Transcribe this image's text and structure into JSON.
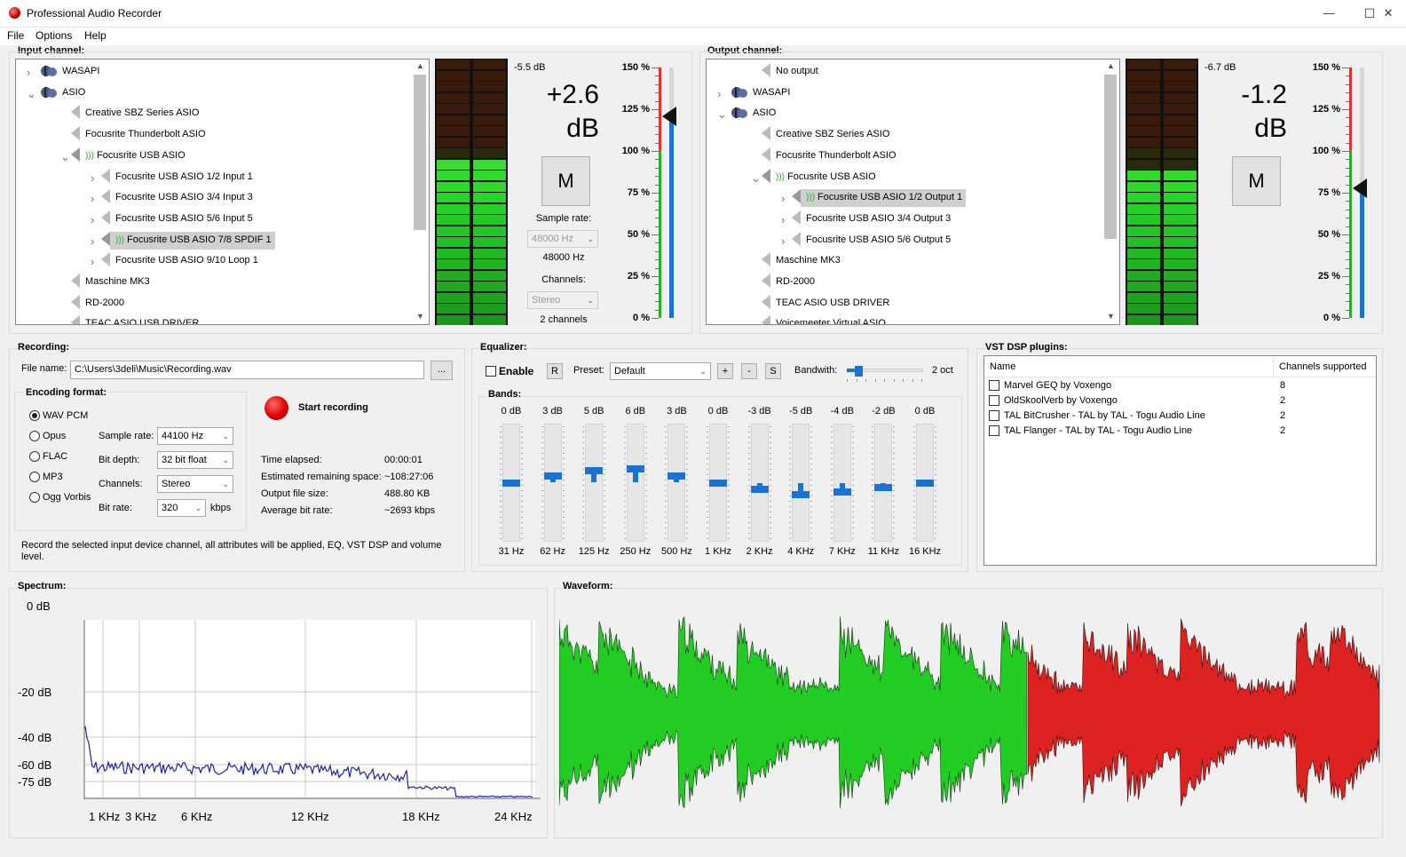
{
  "window": {
    "title": "Professional Audio Recorder",
    "min": "—",
    "max": "☐",
    "close": "✕"
  },
  "menu": [
    "File",
    "Options",
    "Help"
  ],
  "input": {
    "title": "Input channel:",
    "tree": [
      {
        "label": "WASAPI",
        "level": 0,
        "expand": ">",
        "icon": "wasapi"
      },
      {
        "label": "ASIO",
        "level": 0,
        "expand": "v",
        "icon": "wasapi"
      },
      {
        "label": "Creative SBZ Series ASIO",
        "level": 1,
        "expand": "",
        "icon": "spk"
      },
      {
        "label": "Focusrite Thunderbolt ASIO",
        "level": 1,
        "expand": "",
        "icon": "spk"
      },
      {
        "label": "Focusrite USB ASIO",
        "level": 1,
        "expand": "v",
        "icon": "spk-on"
      },
      {
        "label": "Focusrite USB ASIO 1/2 Input 1",
        "level": 2,
        "expand": ">",
        "icon": "spk"
      },
      {
        "label": "Focusrite USB ASIO 3/4 Input 3",
        "level": 2,
        "expand": ">",
        "icon": "spk"
      },
      {
        "label": "Focusrite USB ASIO 5/6 Input 5",
        "level": 2,
        "expand": ">",
        "icon": "spk"
      },
      {
        "label": "Focusrite USB ASIO 7/8 SPDIF 1",
        "level": 2,
        "expand": ">",
        "icon": "spk-on",
        "selected": true
      },
      {
        "label": "Focusrite USB ASIO 9/10 Loop 1",
        "level": 2,
        "expand": ">",
        "icon": "spk"
      },
      {
        "label": "Maschine MK3",
        "level": 1,
        "expand": "",
        "icon": "spk"
      },
      {
        "label": "RD-2000",
        "level": 1,
        "expand": "",
        "icon": "spk"
      },
      {
        "label": "TEAC ASIO USB DRIVER",
        "level": 1,
        "expand": "",
        "icon": "spk"
      }
    ],
    "peak": "-5.5 dB",
    "gain_line1": "+2.6",
    "gain_line2": "dB",
    "mute": "M",
    "sample_rate_label": "Sample rate:",
    "sample_rate_combo": "48000 Hz",
    "sample_rate_value": "48000 Hz",
    "channels_label": "Channels:",
    "channels_combo": "Stereo",
    "channels_value": "2 channels",
    "meter_level": 0.63,
    "volume_level": 0.9
  },
  "output": {
    "title": "Output channel:",
    "tree": [
      {
        "label": "No output",
        "level": 1,
        "expand": "",
        "icon": "spk"
      },
      {
        "label": "WASAPI",
        "level": 0,
        "expand": ">",
        "icon": "wasapi"
      },
      {
        "label": "ASIO",
        "level": 0,
        "expand": "v",
        "icon": "wasapi"
      },
      {
        "label": "Creative SBZ Series ASIO",
        "level": 1,
        "expand": "",
        "icon": "spk"
      },
      {
        "label": "Focusrite Thunderbolt ASIO",
        "level": 1,
        "expand": "",
        "icon": "spk"
      },
      {
        "label": "Focusrite USB ASIO",
        "level": 1,
        "expand": "v",
        "icon": "spk-on"
      },
      {
        "label": "Focusrite USB ASIO 1/2 Output 1",
        "level": 2,
        "expand": ">",
        "icon": "spk-on",
        "selected": true
      },
      {
        "label": "Focusrite USB ASIO 3/4 Output 3",
        "level": 2,
        "expand": ">",
        "icon": "spk"
      },
      {
        "label": "Focusrite USB ASIO 5/6 Output 5",
        "level": 2,
        "expand": ">",
        "icon": "spk"
      },
      {
        "label": "Maschine MK3",
        "level": 1,
        "expand": "",
        "icon": "spk"
      },
      {
        "label": "RD-2000",
        "level": 1,
        "expand": "",
        "icon": "spk"
      },
      {
        "label": "TEAC ASIO USB DRIVER",
        "level": 1,
        "expand": "",
        "icon": "spk"
      },
      {
        "label": "Voicemeeter Virtual ASIO",
        "level": 1,
        "expand": "v",
        "icon": "spk"
      }
    ],
    "peak": "-6.7 dB",
    "gain_line1": "-1.2",
    "gain_line2": "dB",
    "mute": "M",
    "meter_level": 0.6,
    "volume_level": 0.65
  },
  "scale": [
    "150 %",
    "125 %",
    "100 %",
    "75 %",
    "50 %",
    "25 %",
    "0 %"
  ],
  "recording": {
    "title": "Recording:",
    "file_label": "File name:",
    "file_value": "C:\\Users\\3deli\\Music\\Recording.wav",
    "browse": "...",
    "encoding_title": "Encoding format:",
    "formats": [
      "WAV PCM",
      "Opus",
      "FLAC",
      "MP3",
      "Ogg Vorbis"
    ],
    "selected_format": 0,
    "sample_rate_label": "Sample rate:",
    "sample_rate": "44100 Hz",
    "bit_depth_label": "Bit depth:",
    "bit_depth": "32 bit float",
    "channels_label": "Channels:",
    "channels": "Stereo",
    "bit_rate_label": "Bit rate:",
    "bit_rate": "320",
    "bit_rate_unit": "kbps",
    "start": "Start recording",
    "stats": [
      [
        "Time elapsed:",
        "00:00:01"
      ],
      [
        "Estimated remaining space:",
        "~108:27:06"
      ],
      [
        "Output file size:",
        "488.80 KB"
      ],
      [
        "Average bit rate:",
        "~2693 kbps"
      ]
    ],
    "hint": "Record the selected input device channel, all attributes will be applied, EQ, VST DSP and volume level."
  },
  "equalizer": {
    "title": "Equalizer:",
    "enable": "Enable",
    "reset": "R",
    "preset_label": "Preset:",
    "preset": "Default",
    "plus": "+",
    "minus": "-",
    "save": "S",
    "bandwidth_label": "Bandwith:",
    "bandwidth": "2 oct",
    "bandwidth_level": 0.15,
    "bands_title": "Bands:",
    "bands": [
      {
        "gain": "0 dB",
        "freq": "31 Hz",
        "level": 0.5
      },
      {
        "gain": "3 dB",
        "freq": "62 Hz",
        "level": 0.56
      },
      {
        "gain": "5 dB",
        "freq": "125 Hz",
        "level": 0.6
      },
      {
        "gain": "6 dB",
        "freq": "250 Hz",
        "level": 0.62
      },
      {
        "gain": "3 dB",
        "freq": "500 Hz",
        "level": 0.56
      },
      {
        "gain": "0 dB",
        "freq": "1 KHz",
        "level": 0.5
      },
      {
        "gain": "-3 dB",
        "freq": "2 KHz",
        "level": 0.44
      },
      {
        "gain": "-5 dB",
        "freq": "4 KHz",
        "level": 0.4
      },
      {
        "gain": "-4 dB",
        "freq": "7 KHz",
        "level": 0.42
      },
      {
        "gain": "-2 dB",
        "freq": "11 KHz",
        "level": 0.46
      },
      {
        "gain": "0 dB",
        "freq": "16 KHz",
        "level": 0.5
      }
    ]
  },
  "vst": {
    "title": "VST DSP plugins:",
    "col_name": "Name",
    "col_channels": "Channels supported",
    "rows": [
      [
        "Marvel GEQ by Voxengo",
        "8"
      ],
      [
        "OldSkoolVerb by Voxengo",
        "2"
      ],
      [
        "TAL BitCrusher - TAL by TAL - Togu Audio Line",
        "2"
      ],
      [
        "TAL Flanger - TAL by TAL - Togu Audio Line",
        "2"
      ]
    ]
  },
  "spectrum": {
    "title": "Spectrum:",
    "y_labels": [
      "0 dB",
      "-20 dB",
      "-40 dB",
      "-60 dB",
      "-75 dB"
    ],
    "x_labels": [
      "1 KHz",
      "3 KHz",
      "6 KHz",
      "12 KHz",
      "18 KHz",
      "24 KHz"
    ]
  },
  "waveform": {
    "title": "Waveform:",
    "played_color": "#22cc22",
    "remaining_color": "#dd2222",
    "played_fraction": 0.57
  }
}
